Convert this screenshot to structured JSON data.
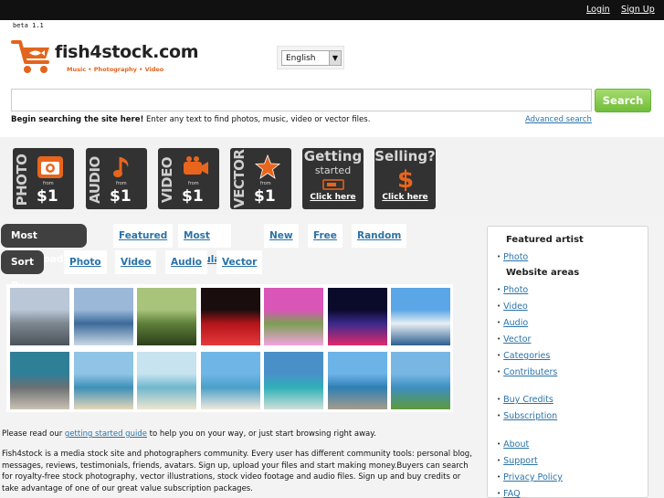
{
  "top_nav": {
    "login": "Login",
    "signup": "Sign Up"
  },
  "beta": "beta 1.1",
  "logo": {
    "brand": "fish4stock.com",
    "tagline": "Music • Photography • Video"
  },
  "language": {
    "selected": "English"
  },
  "search": {
    "value": "",
    "button": "Search",
    "hint_bold": "Begin searching the site here!",
    "hint_rest": " Enter any text to find photos, music, video or vector files.",
    "advanced": "Advanced search"
  },
  "promos": [
    {
      "vertical": "PHOTO",
      "from": "from",
      "price": "$1",
      "icon": "camera-icon"
    },
    {
      "vertical": "AUDIO",
      "from": "from",
      "price": "$1",
      "icon": "music-note-icon"
    },
    {
      "vertical": "VIDEO",
      "from": "from",
      "price": "$1",
      "icon": "video-camera-icon"
    },
    {
      "vertical": "VECTOR",
      "from": "from",
      "price": "$1",
      "icon": "star-icon"
    },
    {
      "big": "Getting",
      "small": "started",
      "click": "Click here",
      "icon": "ticket-icon"
    },
    {
      "big": "Selling?",
      "small": "",
      "click": "Click here",
      "icon": "dollar-icon"
    }
  ],
  "tabs": {
    "row1": [
      "Most downloaded",
      "Featured",
      "Most popular",
      "New",
      "Free",
      "Random"
    ],
    "row2": [
      "Sort By",
      "Photo",
      "Video",
      "Audio",
      "Vector"
    ]
  },
  "thumbnails": [
    {
      "desc": "old building",
      "colors": [
        "#b9c7d6",
        "#7d8790",
        "#4b525a"
      ]
    },
    {
      "desc": "water skier",
      "colors": [
        "#9bb8d8",
        "#3b6a9a",
        "#c9d9e6"
      ]
    },
    {
      "desc": "trees",
      "colors": [
        "#a7c47a",
        "#5e7f3a",
        "#2c3f1b"
      ]
    },
    {
      "desc": "red car",
      "colors": [
        "#1a0d0d",
        "#b3141a",
        "#e63a3a"
      ]
    },
    {
      "desc": "pink flowers",
      "colors": [
        "#d955b8",
        "#7b9f54",
        "#f3a3de"
      ]
    },
    {
      "desc": "night city",
      "colors": [
        "#0a0a2a",
        "#3b2a8c",
        "#e02a6b"
      ]
    },
    {
      "desc": "yacht",
      "colors": [
        "#5aa6e6",
        "#e8eef3",
        "#2b5f8f"
      ]
    },
    {
      "desc": "pelican",
      "colors": [
        "#2f7f97",
        "#6c7073",
        "#c9c2b4"
      ]
    },
    {
      "desc": "beach sea",
      "colors": [
        "#8fc4e6",
        "#3d90b8",
        "#e6d7b8"
      ]
    },
    {
      "desc": "clear sea",
      "colors": [
        "#c6e3ef",
        "#6fb7cf",
        "#eee6cf"
      ]
    },
    {
      "desc": "beach person",
      "colors": [
        "#6fb6e6",
        "#4aa0c9",
        "#efe9dc"
      ]
    },
    {
      "desc": "turquoise water",
      "colors": [
        "#4a90c8",
        "#2fb0b8",
        "#cfe0d7"
      ]
    },
    {
      "desc": "jetty",
      "colors": [
        "#6cb3e8",
        "#2f7fb3",
        "#a59b8a"
      ]
    },
    {
      "desc": "green shore",
      "colors": [
        "#78b7e4",
        "#3d8fc0",
        "#5d9a3a"
      ]
    }
  ],
  "intro": {
    "pre": "Please read our ",
    "link": "getting started guide",
    "post": " to help you on your way, or just start browsing right away."
  },
  "description": "Fish4stock is a media stock site and photographers community. Every user has different community tools: personal blog, messages, reviews, testimonials, friends, avatars. Sign up, upload your files and start making money.Buyers can search for royalty-free stock photography, vector illustrations, stock video footage and audio files. Sign up and buy credits or take advantage of one of our great value subscription packages.",
  "sidebar": {
    "featured_title": "Featured artist",
    "featured_items": [
      "Photo"
    ],
    "areas_title": "Website areas",
    "areas": [
      "Photo",
      "Video",
      "Audio",
      "Vector",
      "Categories",
      "Contributers"
    ],
    "account": [
      "Buy Credits",
      "Subscription"
    ],
    "info": [
      "About",
      "Support",
      "Privacy Policy",
      "FAQ"
    ]
  },
  "colors": {
    "accent_orange": "#e3651d",
    "link_blue": "#2a73a8",
    "search_green": "#71bd3a"
  }
}
